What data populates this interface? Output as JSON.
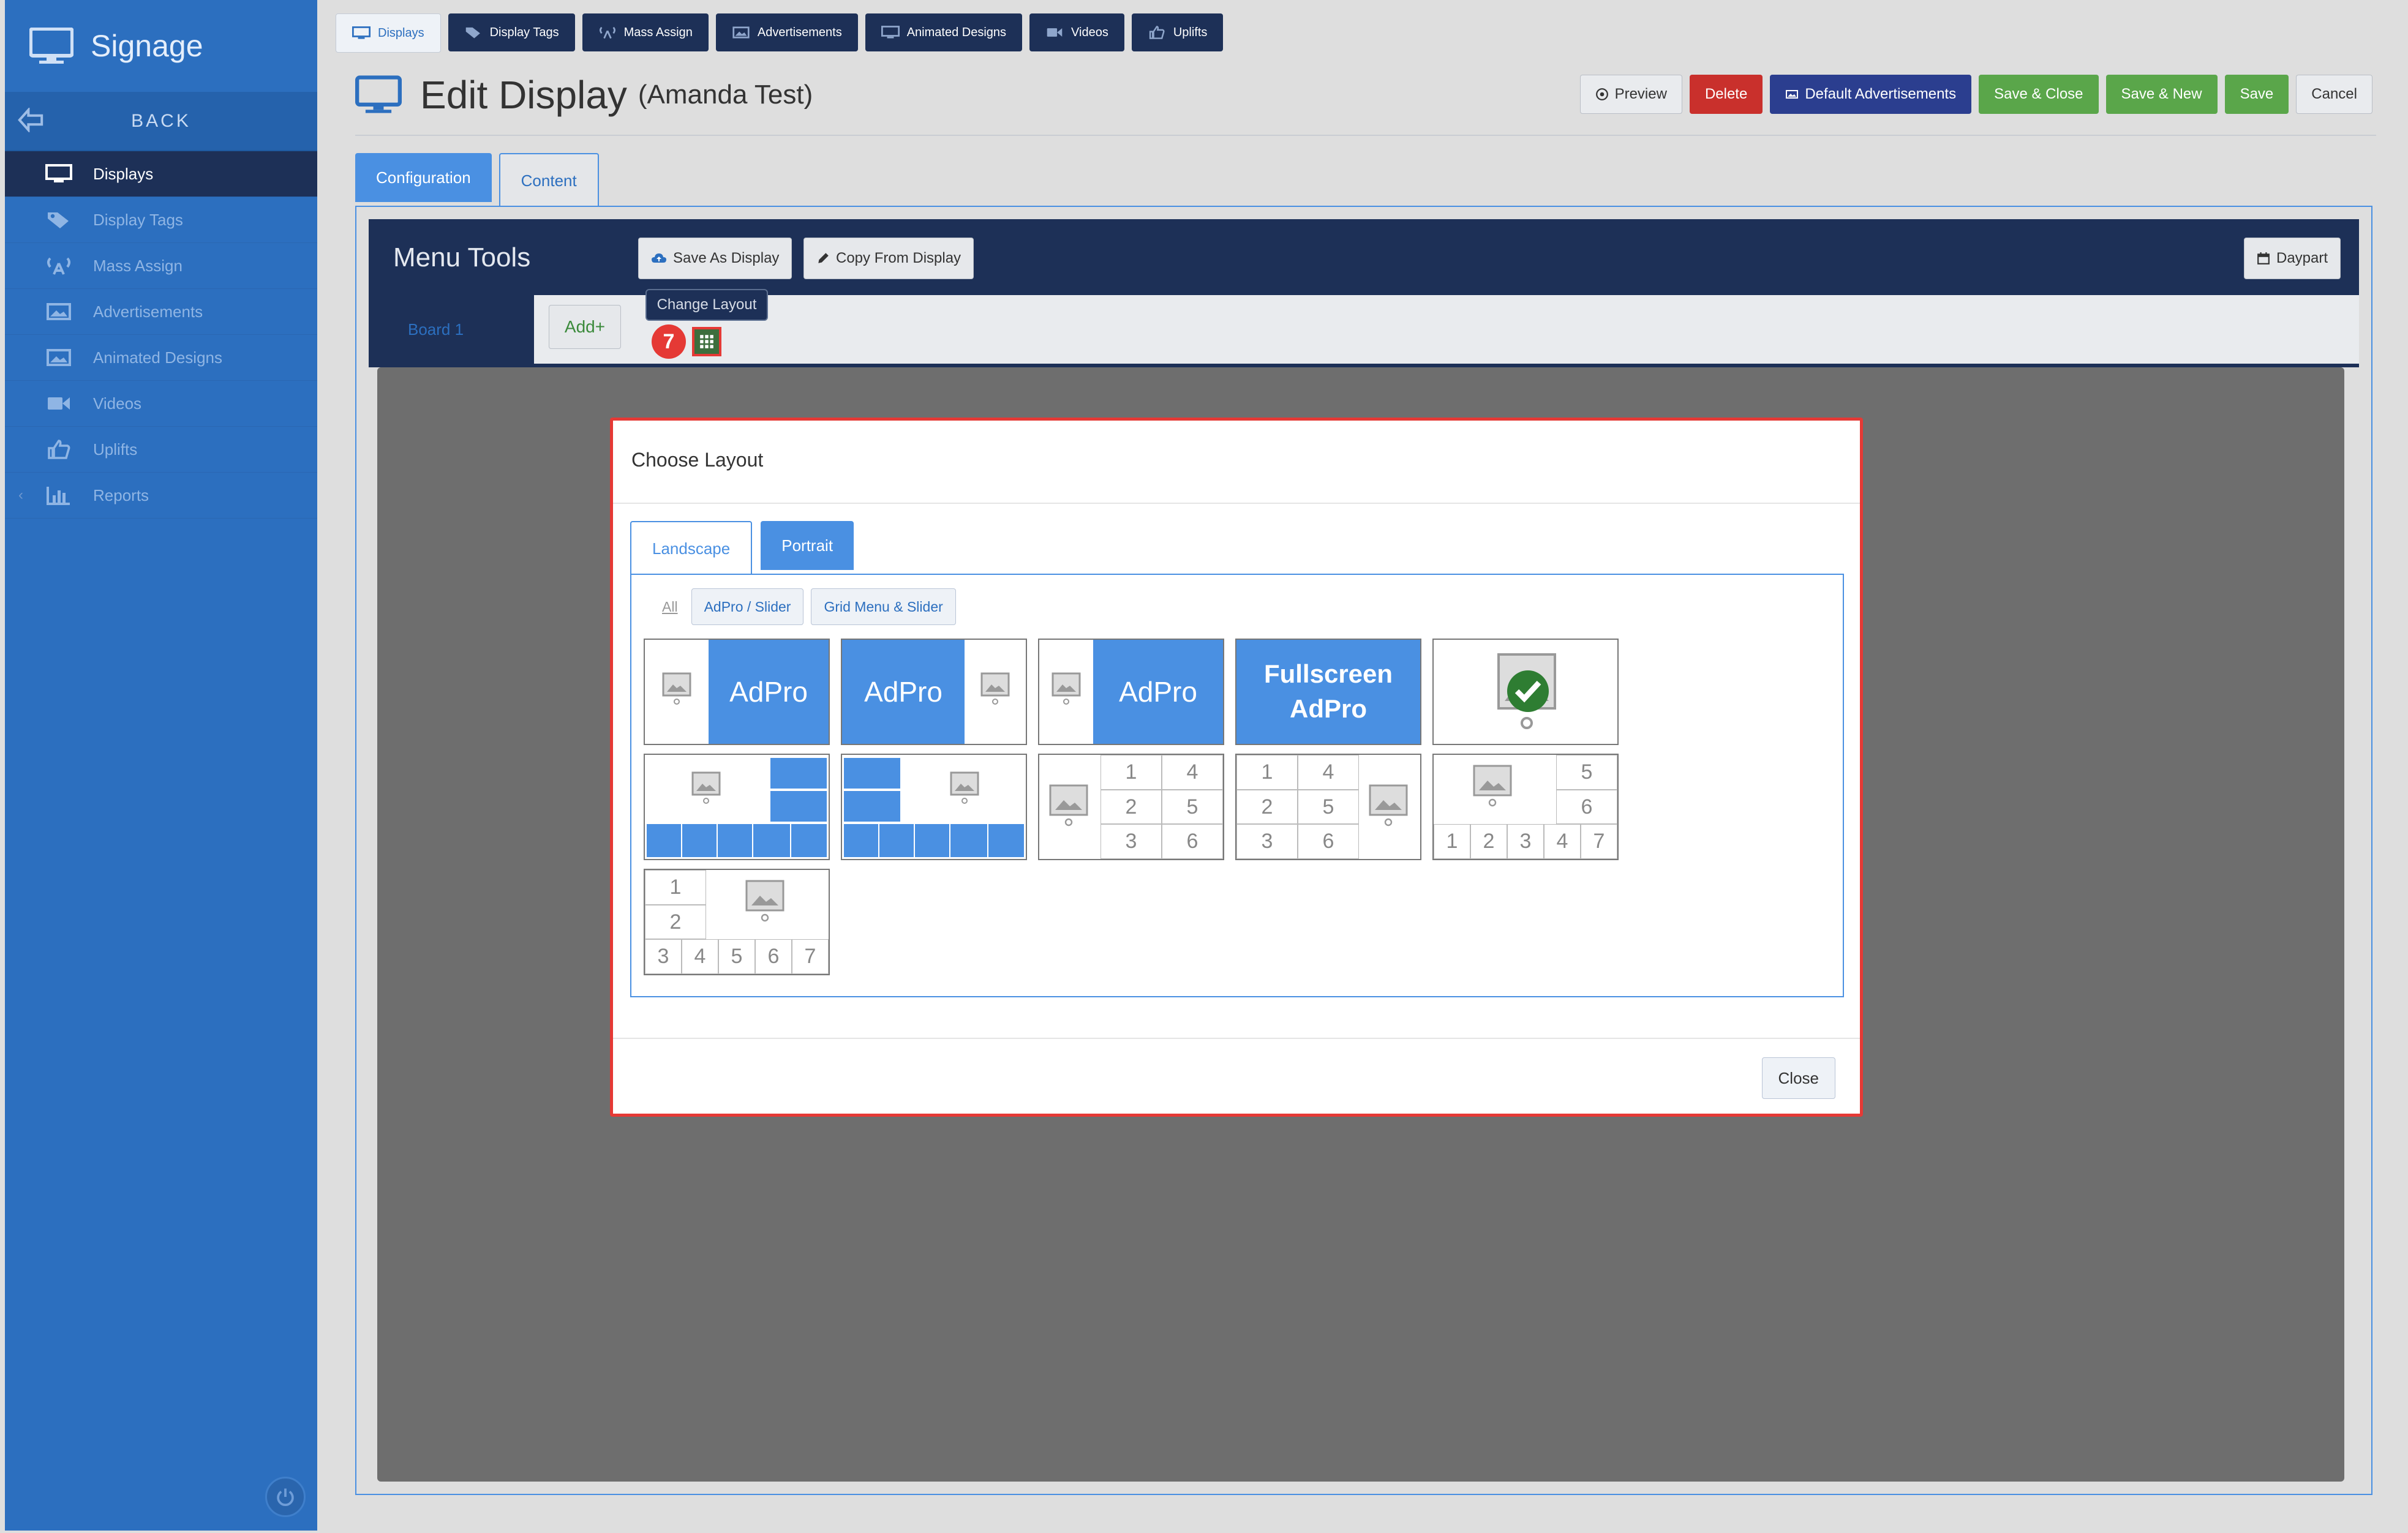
{
  "sidebar": {
    "brand": "Signage",
    "back_label": "BACK",
    "items": [
      {
        "label": "Displays",
        "icon": "monitor-icon",
        "active": true
      },
      {
        "label": "Display Tags",
        "icon": "tags-icon"
      },
      {
        "label": "Mass Assign",
        "icon": "broadcast-icon"
      },
      {
        "label": "Advertisements",
        "icon": "image-icon"
      },
      {
        "label": "Animated Designs",
        "icon": "image-icon"
      },
      {
        "label": "Videos",
        "icon": "video-camera-icon"
      },
      {
        "label": "Uplifts",
        "icon": "thumbs-up-icon"
      },
      {
        "label": "Reports",
        "icon": "bar-chart-icon"
      }
    ]
  },
  "top_tabs": [
    {
      "label": "Displays",
      "icon": "monitor-icon",
      "active": true
    },
    {
      "label": "Display Tags",
      "icon": "tags-icon"
    },
    {
      "label": "Mass Assign",
      "icon": "broadcast-icon"
    },
    {
      "label": "Advertisements",
      "icon": "image-icon"
    },
    {
      "label": "Animated Designs",
      "icon": "monitor-icon"
    },
    {
      "label": "Videos",
      "icon": "video-camera-icon"
    },
    {
      "label": "Uplifts",
      "icon": "thumbs-up-icon"
    }
  ],
  "page": {
    "title": "Edit Display",
    "subtitle": "(Amanda Test)"
  },
  "actions": {
    "preview": "Preview",
    "delete": "Delete",
    "default_ads": "Default Advertisements",
    "save_close": "Save & Close",
    "save_new": "Save & New",
    "save": "Save",
    "cancel": "Cancel"
  },
  "content_tabs": {
    "configuration": "Configuration",
    "content": "Content"
  },
  "menu_tools": {
    "title": "Menu Tools",
    "save_as_display": "Save As Display",
    "copy_from_display": "Copy From Display",
    "daypart": "Daypart"
  },
  "board": {
    "tab_label": "Board 1",
    "add_label": "Add+",
    "tooltip": "Change Layout",
    "step_number": "7"
  },
  "modal": {
    "title": "Choose Layout",
    "orientation_tabs": {
      "landscape": "Landscape",
      "portrait": "Portrait"
    },
    "filters": {
      "all": "All",
      "adpro_slider": "AdPro / Slider",
      "grid_menu_slider": "Grid Menu & Slider"
    },
    "tile_text": {
      "adpro": "AdPro",
      "fullscreen_line1": "Fullscreen",
      "fullscreen_line2": "AdPro"
    },
    "grid_numbers": [
      "1",
      "2",
      "3",
      "4",
      "5",
      "6",
      "7"
    ],
    "close": "Close"
  },
  "colors": {
    "sidebar": "#2c6fbf",
    "navy": "#1d3057",
    "accent_blue": "#4a90e2",
    "danger": "#c9302c",
    "success": "#5aa64a",
    "highlight_red": "#e53935"
  }
}
